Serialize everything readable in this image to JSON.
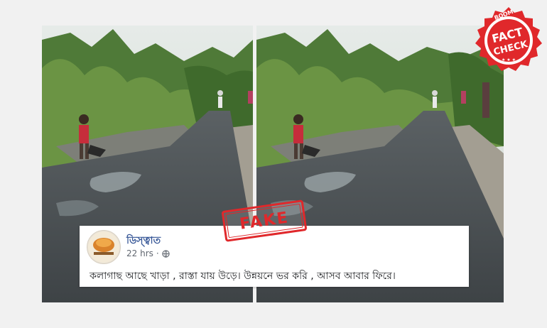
{
  "post": {
    "page_name": "ডিস্ত্বাত",
    "time": "22 hrs",
    "privacy_icon": "globe-icon",
    "text": "কলাগাছ আছে খাড়া , রাস্তা যায় উড়ে। উন্নয়নে ভর করি , আসব আবার ফিরে।"
  },
  "stamp": {
    "label": "FAKE",
    "color": "#e0282b"
  },
  "badge": {
    "brand": "BOOM",
    "line1": "FACT",
    "line2": "CHECK",
    "color": "#e0282b"
  },
  "photos": {
    "left_icon": "road-photo",
    "right_icon": "road-photo"
  }
}
